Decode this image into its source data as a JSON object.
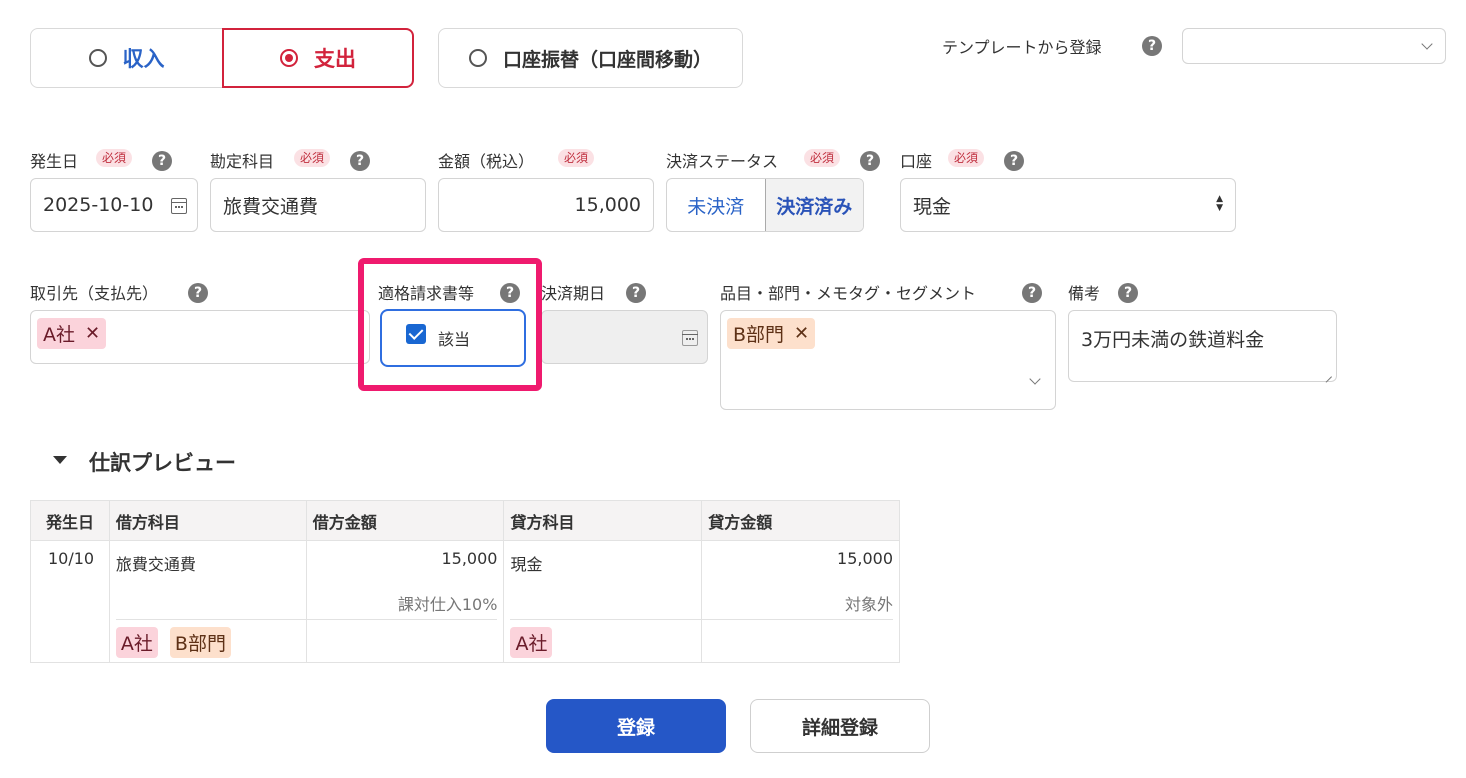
{
  "type_toggle": {
    "income_label": "収入",
    "expense_label": "支出",
    "transfer_label": "口座振替（口座間移動）",
    "selected": "支出"
  },
  "template": {
    "label": "テンプレートから登録",
    "selected": ""
  },
  "help_glyph": "?",
  "required_badge": "必須",
  "fields": {
    "date": {
      "label": "発生日",
      "value": "2025-10-10"
    },
    "account_item": {
      "label": "勘定科目",
      "value": "旅費交通費"
    },
    "amount": {
      "label": "金額（税込）",
      "value": "15,000"
    },
    "settlement_status": {
      "label": "決済ステータス",
      "options": [
        "未決済",
        "決済済み"
      ],
      "selected": "決済済み"
    },
    "wallet": {
      "label": "口座",
      "value": "現金"
    },
    "partner": {
      "label": "取引先（支払先）",
      "tag": "A社"
    },
    "qualified_invoice": {
      "label": "適格請求書等",
      "checkbox_label": "該当",
      "checked": true
    },
    "due_date": {
      "label": "決済期日",
      "value": ""
    },
    "tags": {
      "label": "品目・部門・メモタグ・セグメント",
      "tag": "B部門"
    },
    "note": {
      "label": "備考",
      "value": "3万円未満の鉄道料金"
    }
  },
  "preview": {
    "title": "仕訳プレビュー",
    "headers": [
      "発生日",
      "借方科目",
      "借方金額",
      "貸方科目",
      "貸方金額"
    ],
    "row": {
      "date": "10/10",
      "debit_account": "旅費交通費",
      "debit_amount": "15,000",
      "debit_tax": "課対仕入10%",
      "debit_tags": [
        "A社",
        "B部門"
      ],
      "credit_account": "現金",
      "credit_amount": "15,000",
      "credit_tax": "対象外",
      "credit_tags": [
        "A社"
      ]
    }
  },
  "actions": {
    "register": "登録",
    "detail_register": "詳細登録"
  },
  "colors": {
    "accent_blue": "#2557c7",
    "expense_red": "#d2233c",
    "highlight_pink": "#ef1a6e"
  }
}
